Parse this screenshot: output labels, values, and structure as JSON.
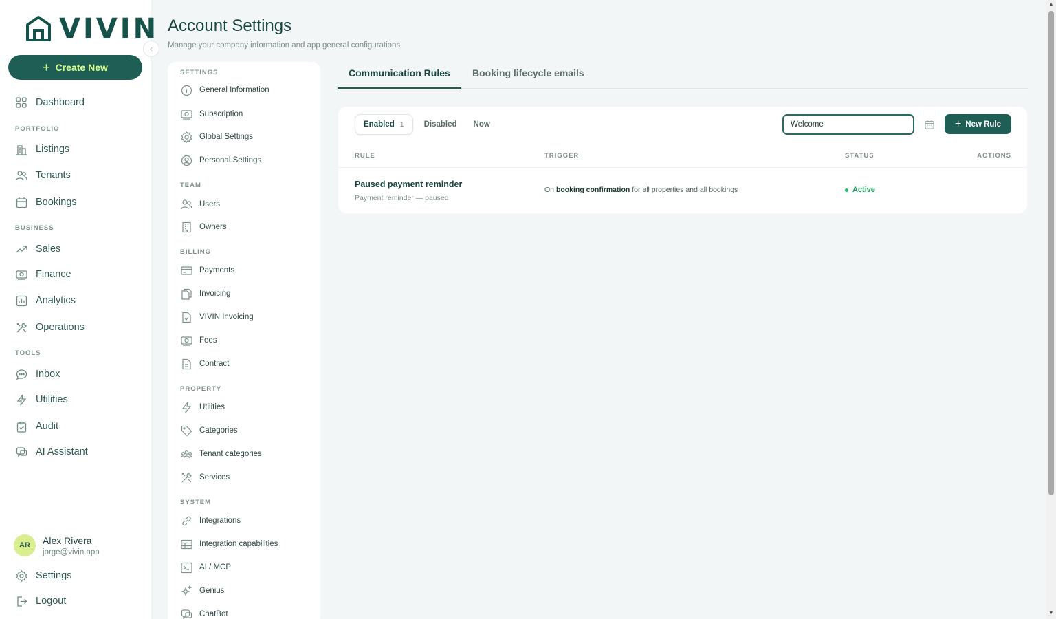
{
  "brand": {
    "name": "VIVIN"
  },
  "sidebar": {
    "create_label": "Create New",
    "items": [
      {
        "label": "Dashboard",
        "icon": "dashboard-icon"
      },
      {
        "label": "Listings",
        "icon": "listings-icon"
      },
      {
        "label": "Tenants",
        "icon": "tenants-icon"
      },
      {
        "label": "Bookings",
        "icon": "calendar-icon"
      },
      {
        "label": "Sales",
        "icon": "trend-icon"
      },
      {
        "label": "Finance",
        "icon": "money-icon"
      },
      {
        "label": "Analytics",
        "icon": "chart-icon"
      },
      {
        "label": "Operations",
        "icon": "tools-icon"
      },
      {
        "label": "Inbox",
        "icon": "chat-icon"
      },
      {
        "label": "Utilities",
        "icon": "bolt-icon"
      },
      {
        "label": "Audit",
        "icon": "clipboard-icon"
      },
      {
        "label": "AI Assistant",
        "icon": "ai-chat-icon"
      }
    ],
    "sections": {
      "portfolio": "PORTFOLIO",
      "business": "BUSINESS",
      "tools": "TOOLS"
    },
    "user": {
      "initials": "AR",
      "name": "Alex Rivera",
      "email": "jorge@vivin.app"
    },
    "settings_label": "Settings",
    "logout_label": "Logout"
  },
  "header": {
    "title": "Account Settings",
    "subtitle": "Manage your company information and app general configurations"
  },
  "settings_nav": {
    "sections": {
      "settings": "SETTINGS",
      "team": "TEAM",
      "billing": "BILLING",
      "property": "PROPERTY",
      "system": "SYSTEM"
    },
    "items": [
      {
        "label": "General Information"
      },
      {
        "label": "Subscription"
      },
      {
        "label": "Global Settings"
      },
      {
        "label": "Personal Settings"
      },
      {
        "label": "Users"
      },
      {
        "label": "Owners"
      },
      {
        "label": "Payments"
      },
      {
        "label": "Invoicing"
      },
      {
        "label": "VIVIN Invoicing"
      },
      {
        "label": "Fees"
      },
      {
        "label": "Contract"
      },
      {
        "label": "Utilities"
      },
      {
        "label": "Categories"
      },
      {
        "label": "Tenant categories"
      },
      {
        "label": "Services"
      },
      {
        "label": "Integrations"
      },
      {
        "label": "Integration capabilities"
      },
      {
        "label": "AI / MCP"
      },
      {
        "label": "Genius"
      },
      {
        "label": "ChatBot"
      }
    ]
  },
  "tabs": [
    {
      "label": "Communication Rules",
      "active": true
    },
    {
      "label": "Booking lifecycle emails",
      "active": false
    }
  ],
  "rules": {
    "filters": [
      {
        "label": "Enabled",
        "count": "1",
        "active": true
      },
      {
        "label": "Disabled",
        "count": "",
        "active": false
      },
      {
        "label": "Now",
        "count": "",
        "active": false
      }
    ],
    "search_value": "Welcome",
    "new_rule_label": "New Rule",
    "columns": {
      "rule": "RULE",
      "trigger": "TRIGGER",
      "status": "STATUS",
      "actions": "ACTIONS"
    },
    "rows": [
      {
        "title": "Paused payment reminder",
        "subtitle": "Payment reminder — paused",
        "trigger_prefix": "On",
        "trigger_event": "booking confirmation",
        "trigger_suffix": "for all properties and all bookings",
        "status": "Active"
      }
    ]
  },
  "colors": {
    "brand": "#1e5e55",
    "accent": "#d9ff8a",
    "status_active": "#1f9a5a"
  }
}
